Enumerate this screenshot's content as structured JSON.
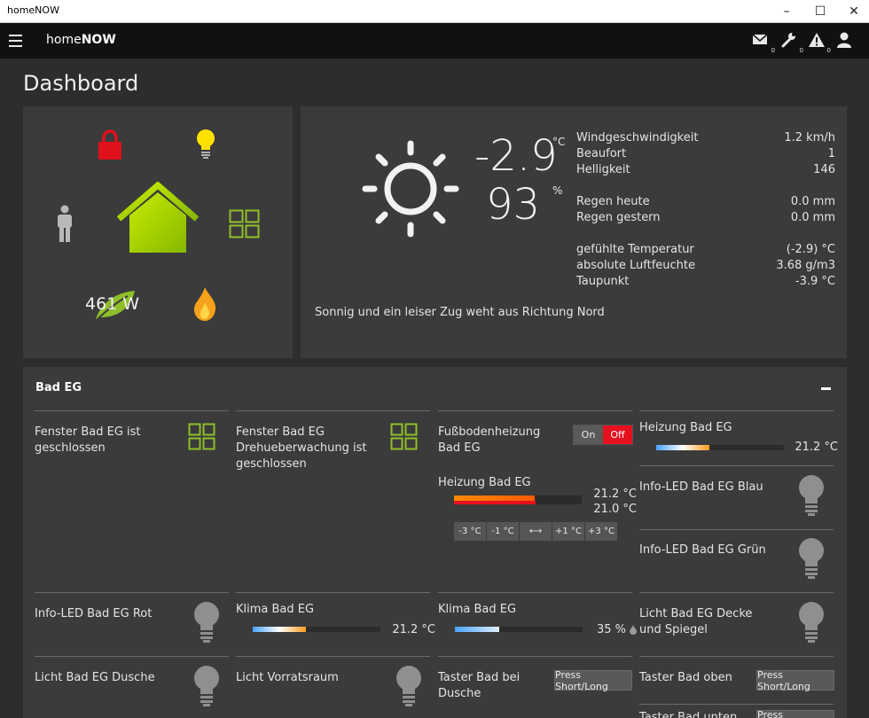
{
  "window": {
    "title": "homeNOW"
  },
  "app": {
    "brand_light": "home",
    "brand_bold": "NOW",
    "messages_count": "0",
    "tools_count": "0",
    "warnings_count": "0"
  },
  "page": {
    "title": "Dashboard"
  },
  "status": {
    "power": "461 W"
  },
  "weather": {
    "temperature": "-2.9",
    "temperature_unit": "°C",
    "humidity": "93",
    "humidity_unit": "%",
    "rows": [
      {
        "label": "Windgeschwindigkeit",
        "value": "1.2 km/h"
      },
      {
        "label": "Beaufort",
        "value": "1"
      },
      {
        "label": "Helligkeit",
        "value": "146"
      },
      {
        "label": "Regen heute",
        "value": "0.0 mm"
      },
      {
        "label": "Regen gestern",
        "value": "0.0 mm"
      },
      {
        "label": "gefühlte Temperatur",
        "value": "(-2.9) °C"
      },
      {
        "label": "absolute Luftfeuchte",
        "value": "3.68 g/m3"
      },
      {
        "label": "Taupunkt",
        "value": "-3.9 °C"
      }
    ],
    "description": "Sonnig und ein leiser Zug weht aus Richtung Nord"
  },
  "section": {
    "title": "Bad EG",
    "fenster_bad": "Fenster Bad EG ist geschlossen",
    "fenster_dreh": "Fenster Bad EG Drehueberwachung ist geschlossen",
    "fussboden": "Fußbodenheizung Bad EG",
    "toggle_on": "On",
    "toggle_off": "Off",
    "heizung1_label": "Heizung Bad EG",
    "heizung1_value": "21.2 °C",
    "heizung1_level": 0.42,
    "heizung2_label": "Heizung Bad EG",
    "heizung2_actual": "21.2 °C",
    "heizung2_target": "21.0 °C",
    "heizung2_level": 0.63,
    "steps": [
      "-3 °C",
      "-1 °C",
      "⟷",
      "+1 °C",
      "+3 °C"
    ],
    "led_blau": "Info-LED Bad EG Blau",
    "led_gruen": "Info-LED Bad EG Grün",
    "led_rot": "Info-LED Bad EG Rot",
    "klima1_label": "Klima Bad EG",
    "klima1_value": "21.2 °C",
    "klima1_level": 0.42,
    "klima2_label": "Klima Bad EG",
    "klima2_value": "35 %",
    "klima2_level": 0.35,
    "licht_decke": "Licht Bad EG Decke und Spiegel",
    "licht_dusche": "Licht Bad EG Dusche",
    "licht_vorrat": "Licht Vorratsraum",
    "taster_dusche": "Taster Bad bei Dusche",
    "taster_oben": "Taster Bad oben",
    "press_label": "Press Short/Long",
    "taster_unten": "Taster Bad unten"
  },
  "colors": {
    "accent_green": "#a7d100",
    "lock_red": "#e0101c",
    "bulb_yellow": "#ffe100",
    "flame_orange": "#f7a21b",
    "off_red": "#e6101f"
  }
}
